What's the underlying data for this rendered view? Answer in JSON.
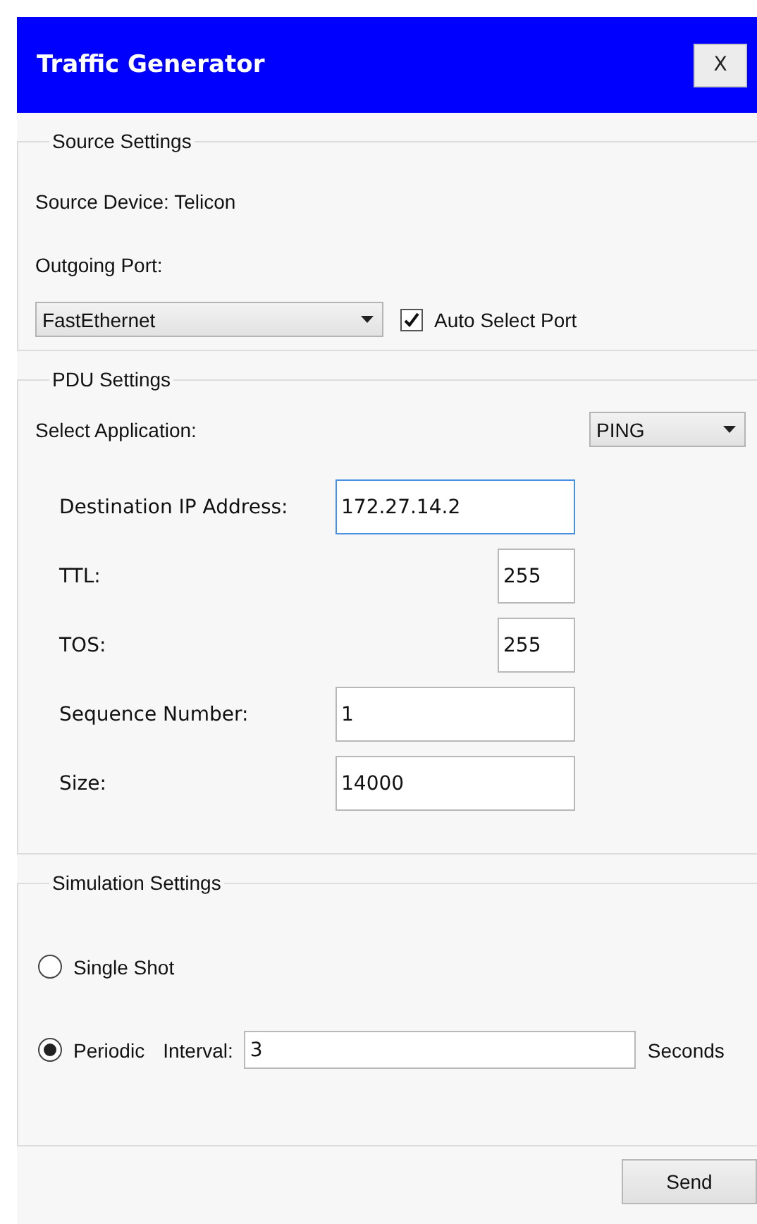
{
  "window": {
    "title": "Traffic Generator",
    "close_button": "X"
  },
  "source_settings": {
    "legend": "Source Settings",
    "source_device": "Source Device: Telicon",
    "outgoing_port_label": "Outgoing Port:",
    "port": {
      "value": "FastEthernet"
    },
    "auto_select": {
      "label": "Auto Select Port",
      "checked": true
    }
  },
  "pdu_settings": {
    "legend": "PDU Settings",
    "select_application_label": "Select Application:",
    "application": {
      "value": "PING"
    },
    "fields": [
      {
        "label": "Destination IP Address:",
        "value": "172.27.14.2",
        "kind": "wide",
        "focused": true
      },
      {
        "label": "TTL:",
        "value": "255",
        "kind": "short",
        "focused": false
      },
      {
        "label": "TOS:",
        "value": "255",
        "kind": "short",
        "focused": false
      },
      {
        "label": "Sequence Number:",
        "value": "1",
        "kind": "wide",
        "focused": false
      },
      {
        "label": "Size:",
        "value": "14000",
        "kind": "wide",
        "focused": false
      }
    ]
  },
  "simulation_settings": {
    "legend": "Simulation Settings",
    "modes": [
      {
        "label": "Single Shot",
        "selected": false
      },
      {
        "label": "Periodic",
        "selected": true,
        "interval": {
          "label": "Interval:",
          "value": "3",
          "unit": "Seconds"
        }
      }
    ]
  },
  "buttons": [
    {
      "label": "Send"
    }
  ]
}
